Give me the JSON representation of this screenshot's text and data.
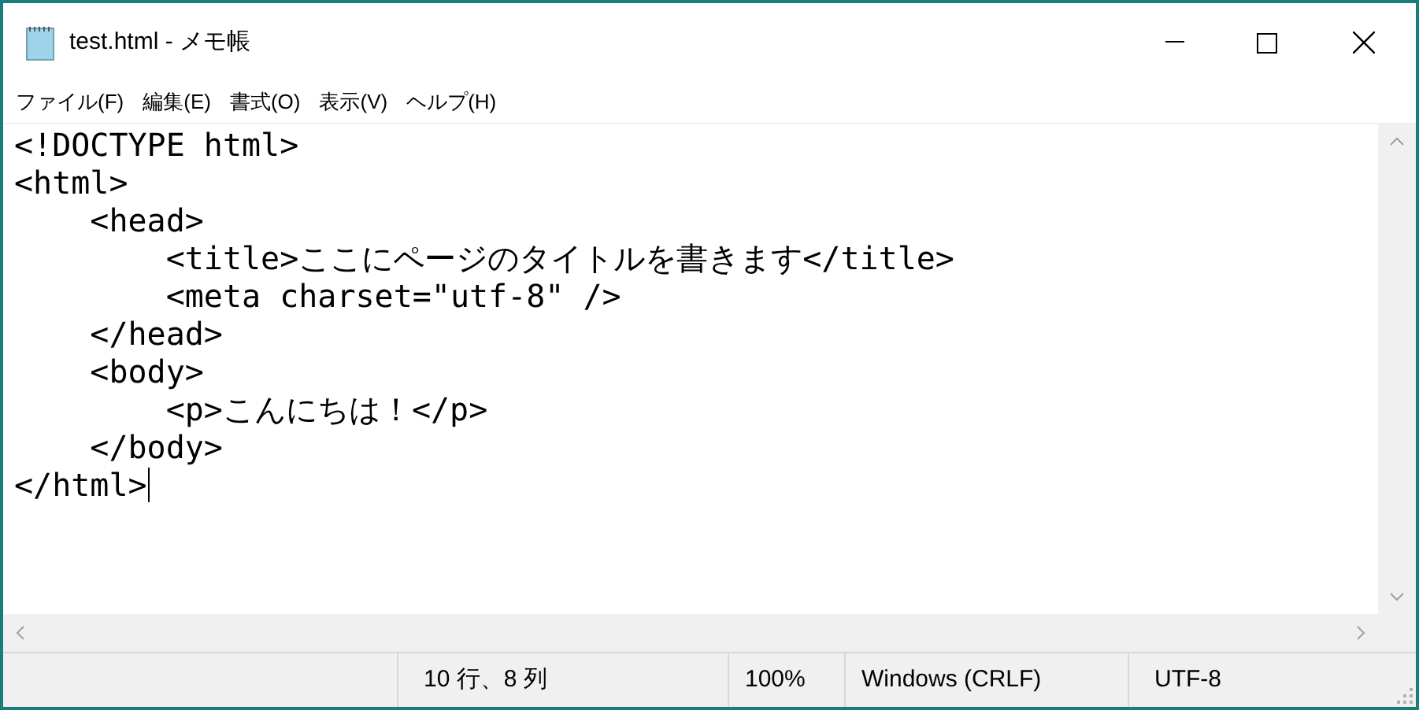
{
  "window": {
    "title": "test.html - メモ帳"
  },
  "menu": [
    "ファイル(F)",
    "編集(E)",
    "書式(O)",
    "表示(V)",
    "ヘルプ(H)"
  ],
  "editor": {
    "lines": [
      "<!DOCTYPE html>",
      "<html>",
      "    <head>",
      "        <title>ここにページのタイトルを書きます</title>",
      "        <meta charset=\"utf-8\" />",
      "    </head>",
      "    <body>",
      "        <p>こんにちは！</p>",
      "    </body>",
      "</html>"
    ]
  },
  "status_bar": [
    "10 行、8 列",
    "100%",
    "Windows (CRLF)",
    "UTF-8"
  ]
}
